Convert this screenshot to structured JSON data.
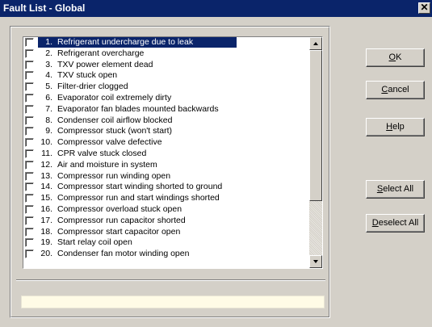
{
  "window": {
    "title": "Fault List - Global",
    "close_glyph": "✕"
  },
  "faults": [
    {
      "num": "1.",
      "label": "Refrigerant undercharge due to leak"
    },
    {
      "num": "2.",
      "label": "Refrigerant overcharge"
    },
    {
      "num": "3.",
      "label": "TXV power element dead"
    },
    {
      "num": "4.",
      "label": "TXV stuck open"
    },
    {
      "num": "5.",
      "label": "Filter-drier clogged"
    },
    {
      "num": "6.",
      "label": "Evaporator coil extremely dirty"
    },
    {
      "num": "7.",
      "label": "Evaporator fan blades mounted backwards"
    },
    {
      "num": "8.",
      "label": "Condenser coil airflow blocked"
    },
    {
      "num": "9.",
      "label": "Compressor stuck (won't start)"
    },
    {
      "num": "10.",
      "label": "Compressor valve defective"
    },
    {
      "num": "11.",
      "label": "CPR valve stuck closed"
    },
    {
      "num": "12.",
      "label": "Air and moisture in system"
    },
    {
      "num": "13.",
      "label": "Compressor run winding open"
    },
    {
      "num": "14.",
      "label": "Compressor start winding shorted to ground"
    },
    {
      "num": "15.",
      "label": "Compressor run and start windings shorted"
    },
    {
      "num": "16.",
      "label": "Compressor overload stuck open"
    },
    {
      "num": "17.",
      "label": "Compressor run capacitor shorted"
    },
    {
      "num": "18.",
      "label": "Compressor start capacitor open"
    },
    {
      "num": "19.",
      "label": "Start relay coil open"
    },
    {
      "num": "20.",
      "label": "Condenser fan motor winding open"
    }
  ],
  "buttons": {
    "ok": {
      "accel": "O",
      "rest": "K"
    },
    "cancel": {
      "accel": "C",
      "rest": "ancel"
    },
    "help": {
      "accel": "H",
      "rest": "elp"
    },
    "select_all": {
      "accel": "S",
      "rest": "elect All"
    },
    "deselect_all": {
      "accel": "D",
      "rest": "eselect All"
    }
  },
  "colors": {
    "title_bg": "#0a246a",
    "dialog_bg": "#d4d0c8",
    "selection": "#0a246a",
    "status_bg": "#fffbe6"
  }
}
